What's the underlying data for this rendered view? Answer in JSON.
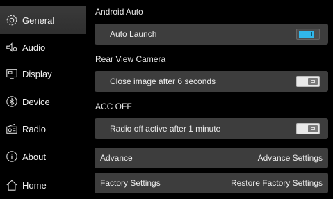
{
  "sidebar": {
    "items": [
      {
        "label": "General",
        "icon": "gear-icon",
        "active": true
      },
      {
        "label": "Audio",
        "icon": "speaker-icon",
        "active": false
      },
      {
        "label": "Display",
        "icon": "display-icon",
        "active": false
      },
      {
        "label": "Device",
        "icon": "bluetooth-icon",
        "active": false
      },
      {
        "label": "Radio",
        "icon": "radio-icon",
        "active": false
      },
      {
        "label": "About",
        "icon": "info-icon",
        "active": false
      },
      {
        "label": "Home",
        "icon": "home-icon",
        "active": false
      }
    ]
  },
  "main": {
    "android_auto": {
      "title": "Android Auto",
      "auto_launch": {
        "label": "Auto Launch",
        "enabled": true
      }
    },
    "rear_view": {
      "title": "Rear View Camera",
      "close_image": {
        "label": "Close image after 6 seconds",
        "enabled": false
      }
    },
    "acc_off": {
      "title": "ACC OFF",
      "radio_off": {
        "label": "Radio off active after 1 minute",
        "enabled": false
      }
    },
    "advance": {
      "label": "Advance",
      "value": "Advance Settings"
    },
    "factory": {
      "label": "Factory Settings",
      "value": "Restore Factory Settings"
    }
  },
  "colors": {
    "toggle_on": "#31b7ea",
    "row_background": "#3d3d3d",
    "active_nav": "#383838"
  }
}
